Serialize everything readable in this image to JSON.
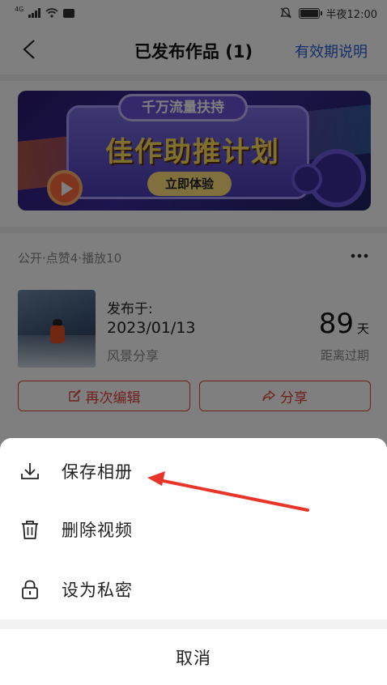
{
  "status_bar": {
    "signal_tag": "4G",
    "time": "半夜12:00"
  },
  "header": {
    "title": "已发布作品 (1)",
    "help_link": "有效期说明"
  },
  "banner": {
    "tag": "千万流量扶持",
    "headline": "佳作助推计划",
    "cta": "立即体验"
  },
  "work": {
    "meta": "公开·点赞4·播放10",
    "published_label": "发布于:",
    "published_date": "2023/01/13",
    "category": "风景分享",
    "days_value": "89",
    "days_unit": "天",
    "days_label": "距离过期",
    "edit_button": "再次编辑",
    "share_button": "分享"
  },
  "sheet": {
    "items": [
      {
        "label": "保存相册",
        "icon": "download-icon"
      },
      {
        "label": "删除视频",
        "icon": "trash-icon"
      },
      {
        "label": "设为私密",
        "icon": "lock-icon"
      }
    ],
    "cancel": "取消"
  },
  "colors": {
    "accent_red": "#e0403a",
    "link_blue": "#2b5fd0",
    "annotation_arrow": "#e8352a"
  }
}
